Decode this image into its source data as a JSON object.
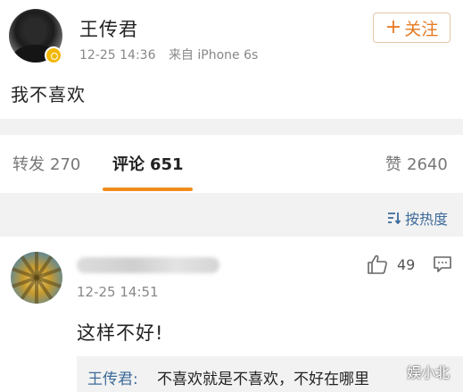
{
  "post": {
    "author": "王传君",
    "time": "12-25 14:36",
    "source": "来自 iPhone 6s",
    "content": "我不喜欢",
    "follow_label": "关注"
  },
  "tabs": {
    "repost_label": "转发",
    "repost_count": "270",
    "comments_label": "评论",
    "comments_count": "651",
    "likes_label": "赞",
    "likes_count": "2640"
  },
  "sort": {
    "label": "按热度"
  },
  "comment": {
    "time": "12-25 14:51",
    "text": "这样不好!",
    "like_count": "49",
    "reply": {
      "author": "王传君:",
      "text": "不喜欢就是不喜欢，不好在哪里"
    }
  },
  "watermark": "娱小北",
  "colors": {
    "accent": "#f08c1d",
    "follow_text": "#e67a23",
    "link_blue": "#3d6b9a",
    "verified_gold": "#f2b705"
  },
  "icons": {
    "verified": "verified-badge-icon",
    "sort": "sort-icon",
    "like": "thumbs-up-icon",
    "reply": "comment-icon"
  }
}
